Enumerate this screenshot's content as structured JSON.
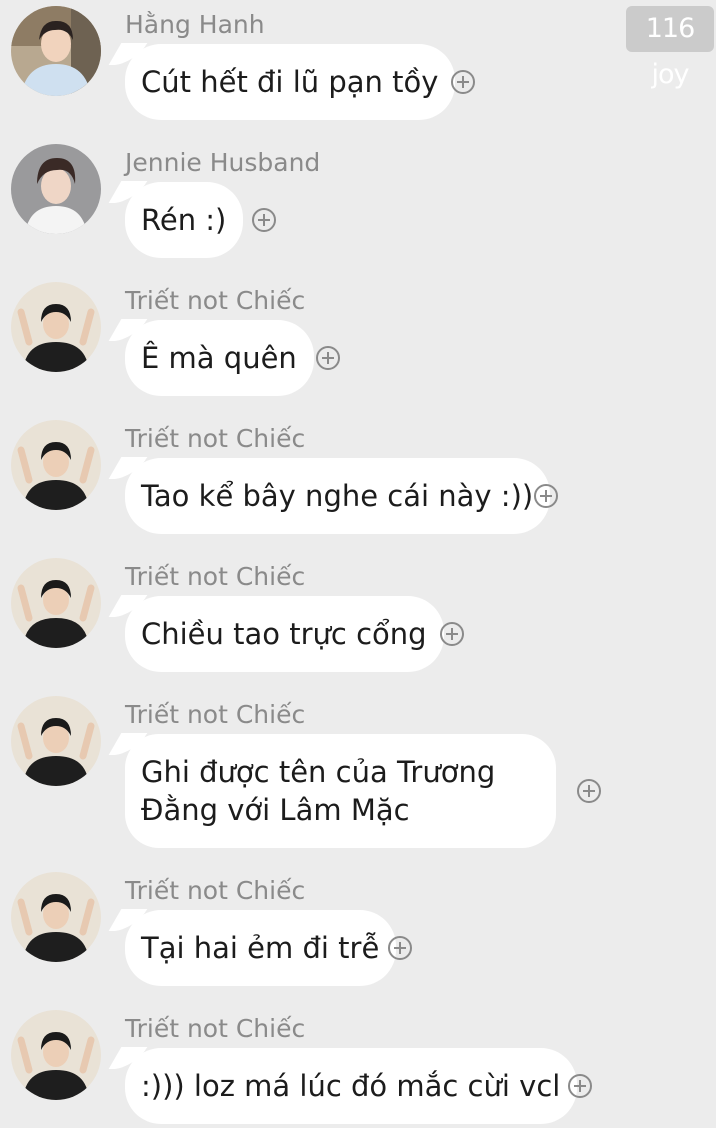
{
  "watermark": "116 joy",
  "messages": [
    {
      "sender": "Hằng Hanh",
      "text": "Cút hết đi lũ pạn tồy",
      "avatar": "avatar-hang-hanh"
    },
    {
      "sender": "Jennie Husband",
      "text": "Rén :)",
      "avatar": "avatar-jennie-husband"
    },
    {
      "sender": "Triết not Chiếc",
      "text": "Ê mà quên",
      "avatar": "avatar-triet"
    },
    {
      "sender": "Triết not Chiếc",
      "text": "Tao kể bây nghe cái này :))",
      "avatar": "avatar-triet"
    },
    {
      "sender": "Triết not Chiếc",
      "text": "Chiều tao trực cổng",
      "avatar": "avatar-triet"
    },
    {
      "sender": "Triết not Chiếc",
      "text": "Ghi được tên của Trương Đằng với Lâm Mặc",
      "avatar": "avatar-triet"
    },
    {
      "sender": "Triết not Chiếc",
      "text": "Tại hai ẻm đi trễ",
      "avatar": "avatar-triet"
    },
    {
      "sender": "Triết not Chiếc",
      "text": ":))) loz má lúc đó mắc cừi vcl",
      "avatar": "avatar-triet"
    }
  ],
  "icons": {
    "reaction": "add-circle-icon"
  },
  "colors": {
    "background": "#ececec",
    "bubble": "#ffffff",
    "sender": "#8a8a8a",
    "text": "#1c1c1c"
  }
}
